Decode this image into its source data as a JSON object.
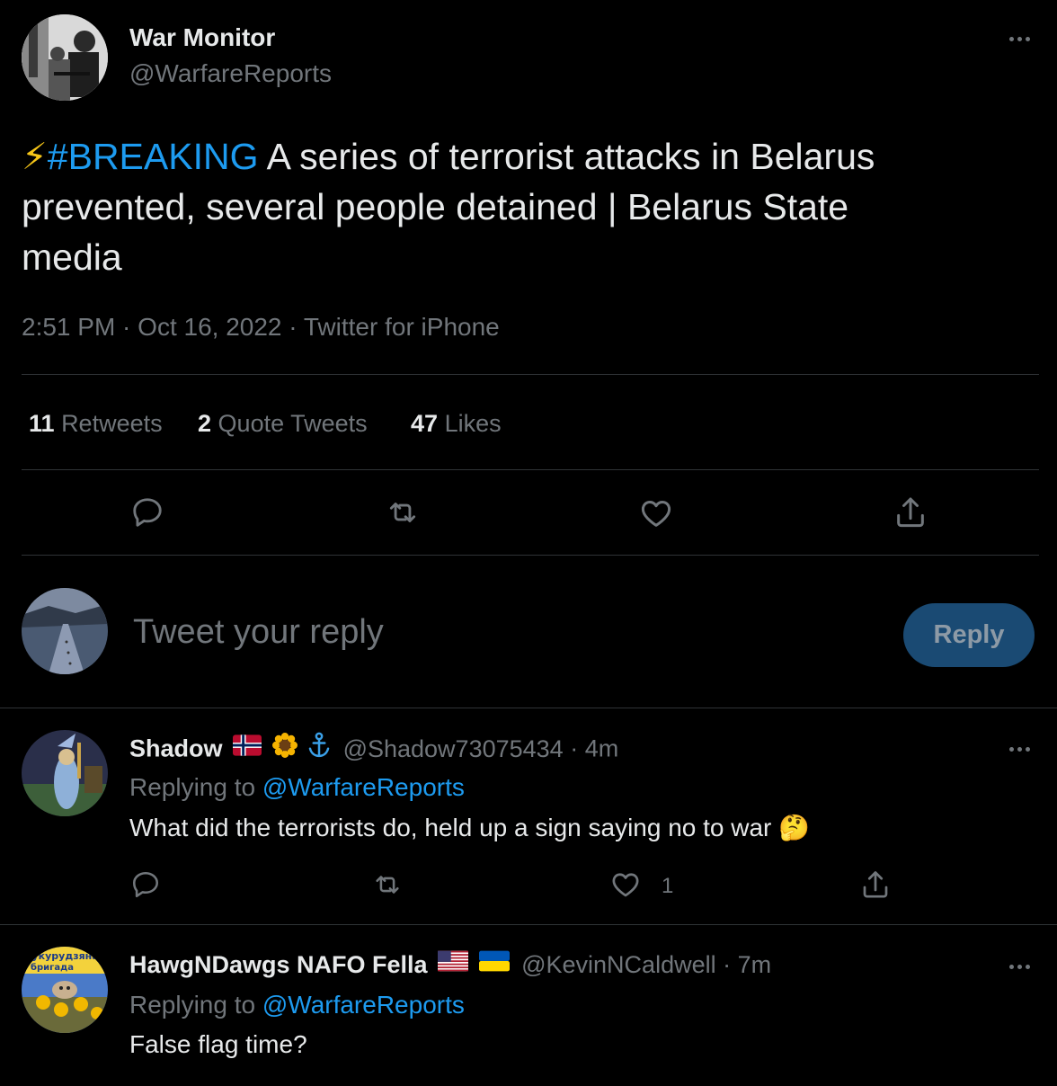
{
  "tweet": {
    "author_name": "War Monitor",
    "author_handle": "@WarfareReports",
    "text_hashtag_prefix": "⚡",
    "hashtag": "#BREAKING",
    "text_line1_rest": " A series of terrorist attacks in Belarus",
    "text_line2": "prevented, several people detained | Belarus State",
    "text_line3": "media",
    "timestamp": "2:51 PM · Oct 16, 2022 · Twitter for iPhone",
    "retweets_count": "11",
    "retweets_label": "Retweets",
    "quotes_count": "2",
    "quotes_label": "Quote Tweets",
    "likes_count": "47",
    "likes_label": "Likes"
  },
  "actions": {
    "icons": [
      "reply-icon",
      "retweet-icon",
      "like-icon",
      "share-icon"
    ]
  },
  "composer": {
    "placeholder": "Tweet your reply",
    "reply_label": "Reply"
  },
  "replies": [
    {
      "name": "Shadow",
      "handle": "@Shadow73075434",
      "age": "· 4m",
      "replying_prefix": "Replying to",
      "replying_to": "@WarfareReports",
      "text": "What did the terrorists do, held up a sign saying no to war",
      "text_emoji": "🤔",
      "like_count": "1"
    },
    {
      "name": "HawgNDawgs NAFO Fella",
      "handle": "@KevinNCaldwell",
      "age": "· 7m",
      "replying_prefix": "Replying to",
      "replying_to": "@WarfareReports",
      "text": "False flag time?",
      "avatar_text_line1": "кукурудзяна",
      "avatar_text_line2": "бригада"
    }
  ],
  "colors": {
    "background": "#000000",
    "text": "#e7e9ea",
    "muted": "#71767b",
    "link": "#1d9bf0",
    "divider": "#2f3336",
    "reply_button": "#1a4a73"
  }
}
